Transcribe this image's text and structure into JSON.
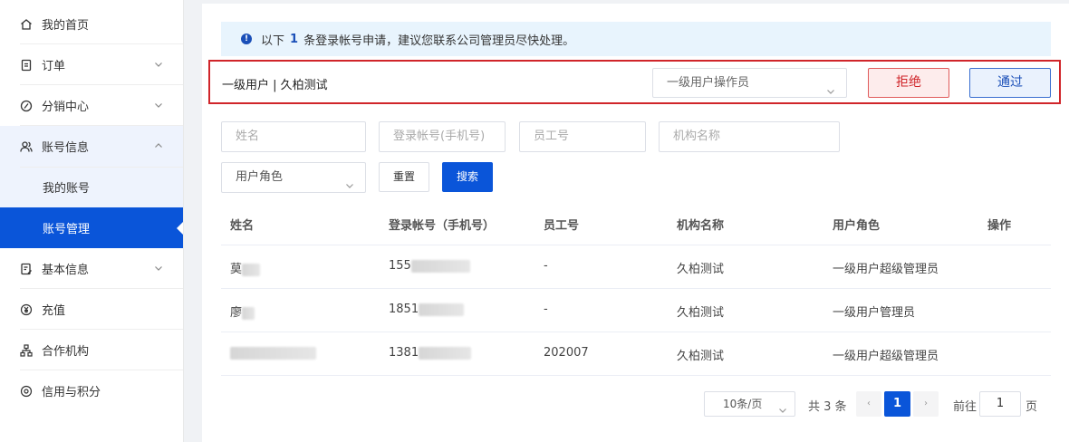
{
  "sidebar": {
    "items": [
      {
        "label": "我的首页"
      },
      {
        "label": "订单"
      },
      {
        "label": "分销中心"
      },
      {
        "label": "账号信息"
      },
      {
        "label": "我的账号"
      },
      {
        "label": "账号管理"
      },
      {
        "label": "基本信息"
      },
      {
        "label": "充值"
      },
      {
        "label": "合作机构"
      },
      {
        "label": "信用与积分"
      }
    ]
  },
  "notice": {
    "prefix": "以下",
    "count": "1",
    "suffix": "条登录帐号申请，建议您联系公司管理员尽快处理。"
  },
  "request": {
    "applicant": "一级用户 | 久柏测试",
    "role_select": "一级用户操作员",
    "reject_label": "拒绝",
    "approve_label": "通过"
  },
  "filters": {
    "name_placeholder": "姓名",
    "account_placeholder": "登录帐号(手机号)",
    "employee_placeholder": "员工号",
    "org_placeholder": "机构名称",
    "role_placeholder": "用户角色",
    "reset_label": "重置",
    "search_label": "搜索"
  },
  "table": {
    "headers": [
      "姓名",
      "登录帐号（手机号）",
      "员工号",
      "机构名称",
      "用户角色",
      "操作"
    ],
    "rows": [
      {
        "name": "莫",
        "account": "155",
        "employee": "-",
        "org": "久柏测试",
        "role": "一级用户超级管理员"
      },
      {
        "name": "廖",
        "account": "1851",
        "employee": "-",
        "org": "久柏测试",
        "role": "一级用户管理员"
      },
      {
        "name": "",
        "account": "1381",
        "employee": "202007",
        "org": "久柏测试",
        "role": "一级用户超级管理员"
      }
    ]
  },
  "pagination": {
    "page_size": "10条/页",
    "total": "共 3 条",
    "current": "1",
    "goto_label": "前往",
    "goto_value": "1",
    "page_label": "页"
  }
}
